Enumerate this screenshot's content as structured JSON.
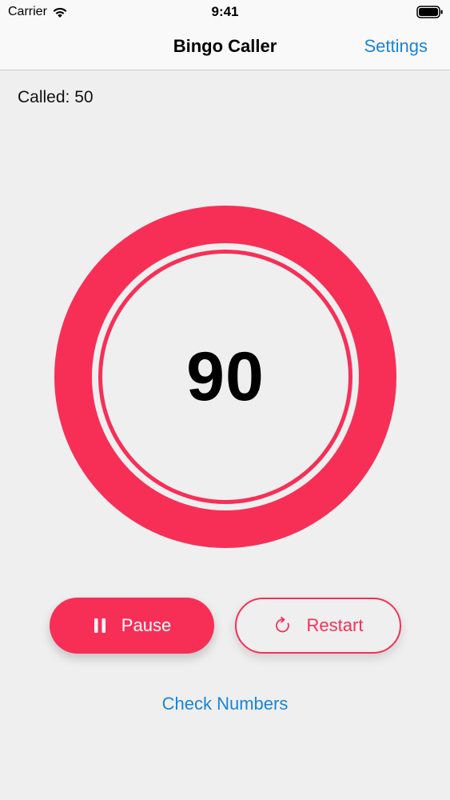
{
  "status_bar": {
    "carrier": "Carrier",
    "time": "9:41",
    "icons": [
      "wifi-icon",
      "battery-icon"
    ]
  },
  "nav": {
    "title": "Bingo Caller",
    "settings_label": "Settings"
  },
  "main": {
    "called_label": "Called: 50",
    "current_number": "90"
  },
  "controls": {
    "pause_label": "Pause",
    "pause_icon": "pause-icon",
    "restart_label": "Restart",
    "restart_icon": "restart-icon",
    "check_label": "Check Numbers"
  },
  "colors": {
    "accent": "#f72f57",
    "link": "#1a84d8",
    "background": "#efeff0"
  }
}
